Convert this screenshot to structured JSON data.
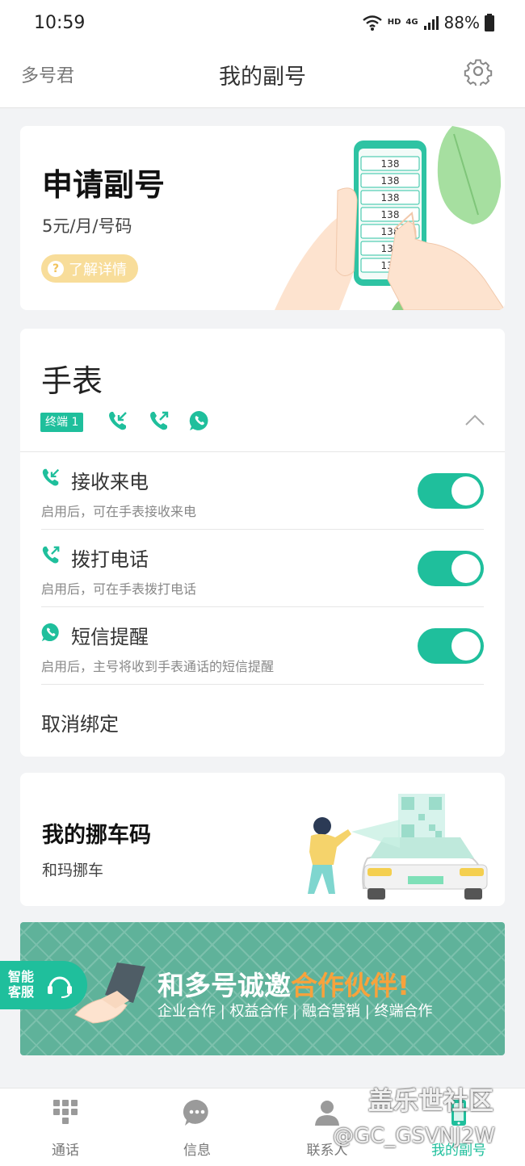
{
  "status_bar": {
    "time": "10:59",
    "network_hd": "HD",
    "network_4g": "4G",
    "battery": "88%"
  },
  "header": {
    "left_label": "多号君",
    "title": "我的副号",
    "settings_icon": "gear-icon"
  },
  "apply_card": {
    "title": "申请副号",
    "price": "5元/月/号码",
    "details_label": "了解详情",
    "details_icon": "question-icon",
    "phone_numbers": [
      "138",
      "138",
      "138",
      "138",
      "138",
      "138",
      "138"
    ]
  },
  "watch_card": {
    "device_name": "手表",
    "terminal_label": "终端 1",
    "collapse_icon": "chevron-up-icon",
    "rows": [
      {
        "icon": "incoming-call-icon",
        "title": "接收来电",
        "subtitle": "启用后，可在手表接收来电",
        "enabled": true
      },
      {
        "icon": "outgoing-call-icon",
        "title": "拨打电话",
        "subtitle": "启用后，可在手表拨打电话",
        "enabled": true
      },
      {
        "icon": "sms-bubble-icon",
        "title": "短信提醒",
        "subtitle": "启用后，主号将收到手表通话的短信提醒",
        "enabled": true
      }
    ],
    "unbind_label": "取消绑定"
  },
  "parking_card": {
    "title": "我的挪车码",
    "subtitle": "和玛挪车"
  },
  "banner": {
    "line1_prefix": "和多号诚邀",
    "line1_highlight": "合作伙伴!",
    "line2": "企业合作 | 权益合作 | 融合营销 | 终端合作"
  },
  "service_button": {
    "line1": "智能",
    "line2": "客服",
    "icon": "headset-icon"
  },
  "tabs": [
    {
      "label": "通话",
      "icon": "dialpad-icon",
      "active": false
    },
    {
      "label": "信息",
      "icon": "chat-bubble-icon",
      "active": false
    },
    {
      "label": "联系人",
      "icon": "person-icon",
      "active": false
    },
    {
      "label": "我的副号",
      "icon": "phone-icon",
      "active": true
    }
  ],
  "watermark": {
    "line1": "盖乐世社区",
    "line2": "@GC_GSVNJ2W"
  },
  "colors": {
    "accent": "#1fbf9c",
    "pill": "#f8dd9a",
    "banner": "#5fb29a",
    "banner_highlight": "#f7a23c"
  }
}
